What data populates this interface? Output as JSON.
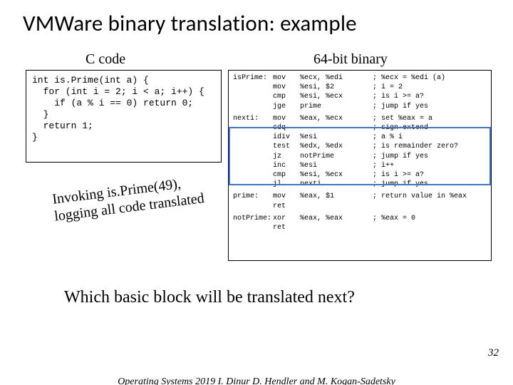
{
  "title": "VMWare binary translation: example",
  "columns": {
    "c": "C code",
    "bin": "64-bit binary"
  },
  "c_code": "int is.Prime(int a) {\n  for (int i = 2; i < a; i++) {\n    if (a % i == 0) return 0;\n  }\n  return 1;\n}",
  "asm": [
    {
      "l": "isPrime:",
      "op": "mov",
      "args": "%ecx, %edi",
      "c": "; %ecx = %edi (a)"
    },
    {
      "l": "",
      "op": "mov",
      "args": "%esi, $2",
      "c": "; i = 2"
    },
    {
      "l": "",
      "op": "cmp",
      "args": "%esi, %ecx",
      "c": "; is i >= a?"
    },
    {
      "l": "",
      "op": "jge",
      "args": "prime",
      "c": "; jump if yes"
    },
    {
      "sep": true
    },
    {
      "l": "nexti:",
      "op": "mov",
      "args": "%eax, %ecx",
      "c": "; set %eax = a"
    },
    {
      "l": "",
      "op": "cdq",
      "args": "",
      "c": "; sign-extend"
    },
    {
      "l": "",
      "op": "idiv",
      "args": "%esi",
      "c": "; a % i"
    },
    {
      "l": "",
      "op": "test",
      "args": "%edx, %edx",
      "c": "; is remainder zero?"
    },
    {
      "l": "",
      "op": "jz",
      "args": "notPrime",
      "c": "; jump if yes"
    },
    {
      "l": "",
      "op": "inc",
      "args": "%esi",
      "c": "; i++"
    },
    {
      "l": "",
      "op": "cmp",
      "args": "%esi, %ecx",
      "c": "; is i >= a?"
    },
    {
      "l": "",
      "op": "jl",
      "args": "nexti",
      "c": "; jump if yes"
    },
    {
      "sep": true
    },
    {
      "l": "prime:",
      "op": "mov",
      "args": "%eax, $1",
      "c": "; return value in %eax"
    },
    {
      "l": "",
      "op": "ret",
      "args": "",
      "c": ""
    },
    {
      "sep": true
    },
    {
      "l": "notPrime:",
      "op": "xor",
      "args": "%eax, %eax",
      "c": "; %eax = 0"
    },
    {
      "l": "",
      "op": "ret",
      "args": "",
      "c": ""
    }
  ],
  "annotation_line1": "Invoking is.Prime(49),",
  "annotation_line2": "logging all code translated",
  "question": "Which basic block will be translated next?",
  "page_number": "32",
  "footer": "Operating Systems 2019   I. Dinur   D. Hendler and M. Kogan-Sadetsky"
}
